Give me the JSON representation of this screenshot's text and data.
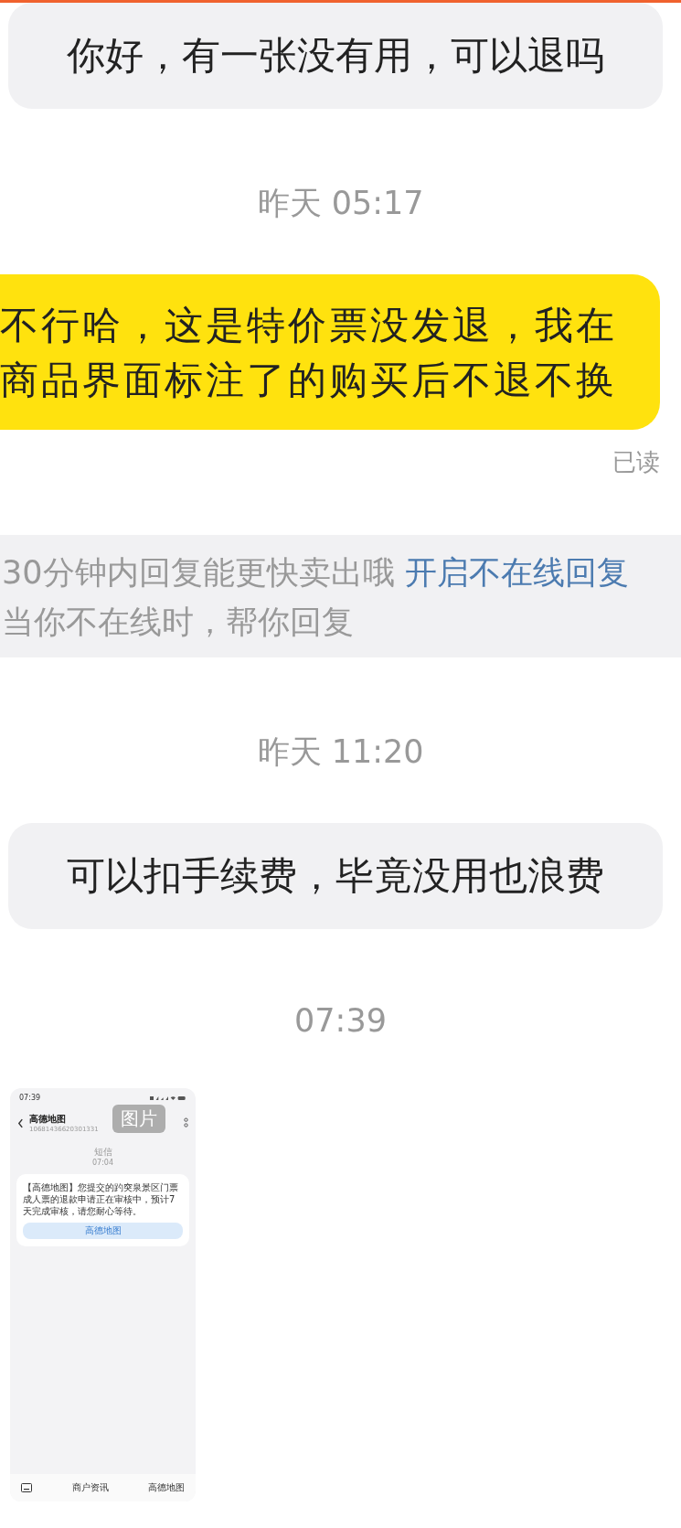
{
  "messages": [
    {
      "kind": "received",
      "lines": [
        "你好，有一张没有用，可以退吗"
      ]
    },
    {
      "kind": "time",
      "text": "昨天 05:17"
    },
    {
      "kind": "sent",
      "lines": [
        "不行哈，这是特价票没发退，我在",
        "商品界面标注了的购买后不退不换"
      ],
      "status": "已读"
    },
    {
      "kind": "notice",
      "text": "30分钟内回复能更快卖出哦",
      "link": "开启不在线回复",
      "subtext": "当你不在线时，帮你回复"
    },
    {
      "kind": "time",
      "text": "昨天 11:20"
    },
    {
      "kind": "received",
      "lines": [
        "可以扣手续费，毕竟没用也浪费"
      ]
    },
    {
      "kind": "time",
      "text": "07:39"
    },
    {
      "kind": "image",
      "badge": "图片",
      "screenshot": {
        "clock": "07:39",
        "title": "高德地图",
        "number": "10681436620301331",
        "label": "短信",
        "time": "07:04",
        "message": "【高德地图】您提交的趵突泉景区门票成人票的退款申请正在审核中，预计7天完成审核，请您耐心等待。",
        "button": "高德地图",
        "tabs": [
          "商户资讯",
          "高德地图"
        ]
      }
    }
  ]
}
